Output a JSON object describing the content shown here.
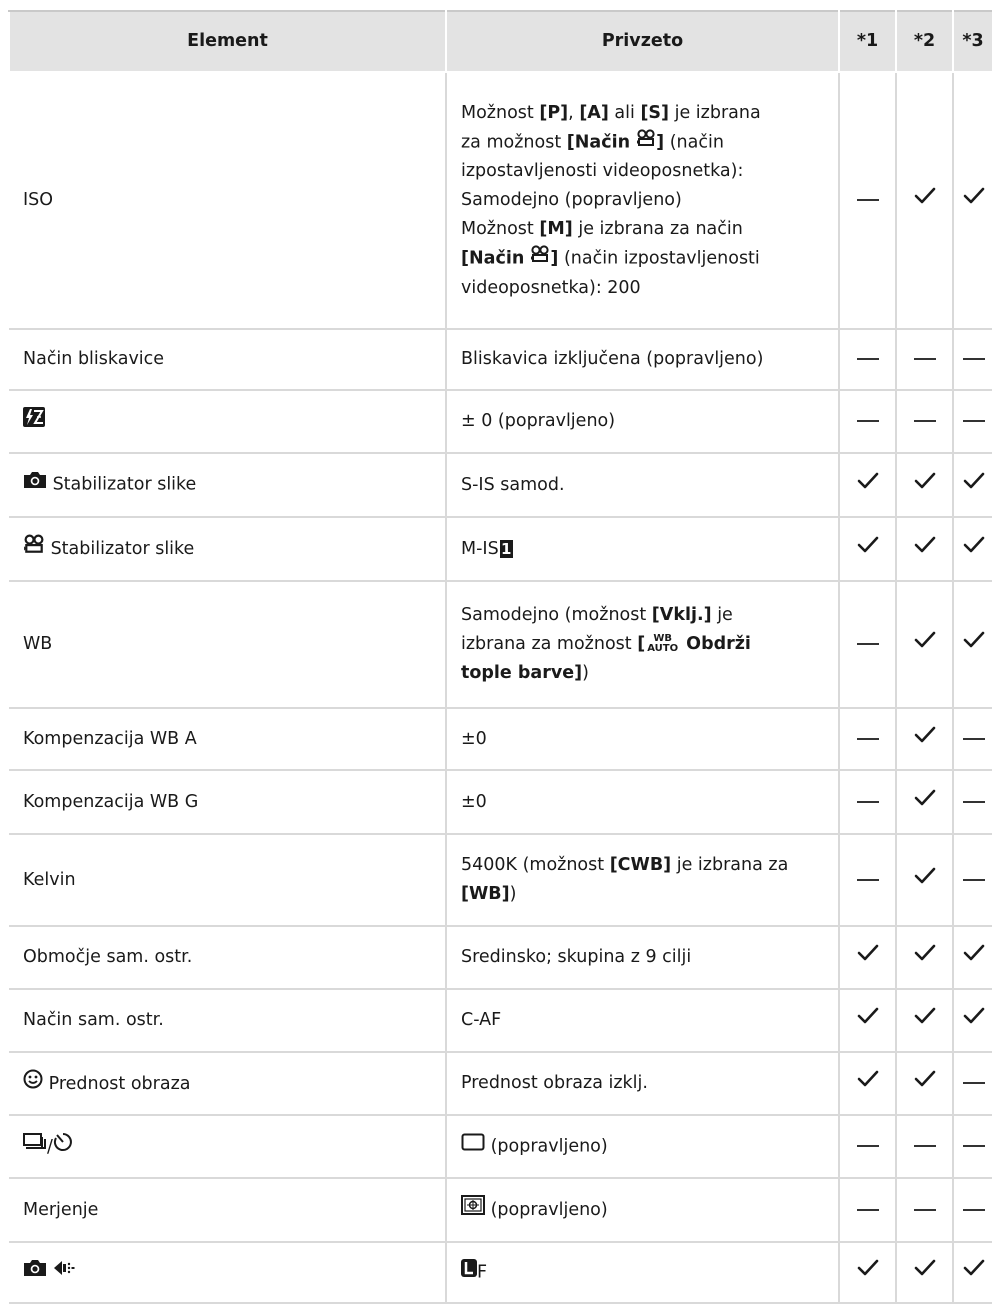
{
  "headers": {
    "element": "Element",
    "default": "Privzeto",
    "col1": "*1",
    "col2": "*2",
    "col3": "*3"
  },
  "rows": [
    {
      "element": "ISO",
      "marks": [
        "dash",
        "check",
        "check"
      ],
      "default": {
        "l1a": "Možnost ",
        "l1b": "[P]",
        "l1c": ", ",
        "l1d": "[A]",
        "l1e": " ali ",
        "l1f": "[S]",
        "l1g": " je izbrana",
        "l2a": "za možnost ",
        "l2b": "[Način ",
        "l2c": "]",
        "l2d": " (način",
        "l3": "izpostavljenosti videoposnetka):",
        "l4": "Samodejno (popravljeno)",
        "l5a": "Možnost ",
        "l5b": "[M]",
        "l5c": " je izbrana za način",
        "l6a": "[Način ",
        "l6b": "]",
        "l6c": " (način izpostavljenosti",
        "l7": "videoposnetka): 200"
      }
    },
    {
      "element": "Način bliskavice",
      "default": "Bliskavica izključena (popravljeno)",
      "marks": [
        "dash",
        "dash",
        "dash"
      ]
    },
    {
      "element_icon": "flash-compensation-icon",
      "default": "± 0 (popravljeno)",
      "marks": [
        "dash",
        "dash",
        "dash"
      ]
    },
    {
      "element_icon": "camera-icon",
      "element": "Stabilizator slike",
      "default": "S-IS samod.",
      "marks": [
        "check",
        "check",
        "check"
      ]
    },
    {
      "element_icon": "movie-icon",
      "element": "Stabilizator slike",
      "default": "M-IS",
      "default_badge": "1",
      "marks": [
        "check",
        "check",
        "check"
      ]
    },
    {
      "element": "WB",
      "marks": [
        "dash",
        "check",
        "check"
      ],
      "default": {
        "l1a": "Samodejno (možnost ",
        "l1b": "[Vklj.]",
        "l1c": " je",
        "l2a": "izbrana za možnost ",
        "l2b": "[",
        "l2c": "WB",
        "l2d": "AUTO",
        "l2e": " Obdrži",
        "l3a": "tople barve]",
        "l3b": ")"
      }
    },
    {
      "element": "Kompenzacija WB A",
      "default": "±0",
      "marks": [
        "dash",
        "check",
        "dash"
      ]
    },
    {
      "element": "Kompenzacija WB G",
      "default": "±0",
      "marks": [
        "dash",
        "check",
        "dash"
      ]
    },
    {
      "element": "Kelvin",
      "marks": [
        "dash",
        "check",
        "dash"
      ],
      "default": {
        "l1a": "5400K (možnost ",
        "l1b": "[CWB]",
        "l1c": " je izbrana za",
        "l2a": "[WB]",
        "l2b": ")"
      }
    },
    {
      "element": "Območje sam. ostr.",
      "default": "Sredinsko; skupina z 9 cilji",
      "marks": [
        "check",
        "check",
        "check"
      ]
    },
    {
      "element": "Način sam. ostr.",
      "default": "C-AF",
      "marks": [
        "check",
        "check",
        "check"
      ]
    },
    {
      "element_icon": "face-priority-icon",
      "element": "Prednost obraza",
      "default": "Prednost obraza izklj.",
      "marks": [
        "check",
        "check",
        "dash"
      ]
    },
    {
      "element_icon": "drive-self-timer-icon",
      "element_sep": "/",
      "default_icon": "single-frame-icon",
      "default": "(popravljeno)",
      "marks": [
        "dash",
        "dash",
        "dash"
      ]
    },
    {
      "element": "Merjenje",
      "default_icon": "metering-icon",
      "default": "(popravljeno)",
      "marks": [
        "dash",
        "dash",
        "dash"
      ]
    },
    {
      "element_icon": "camera-image-quality-icon",
      "default_icon": "large-size-icon",
      "default": "F",
      "marks": [
        "check",
        "check",
        "check"
      ]
    }
  ],
  "colors": {
    "header_bg": "#e3e3e3",
    "border": "#d9d9d9",
    "text": "#1a1a1a"
  }
}
